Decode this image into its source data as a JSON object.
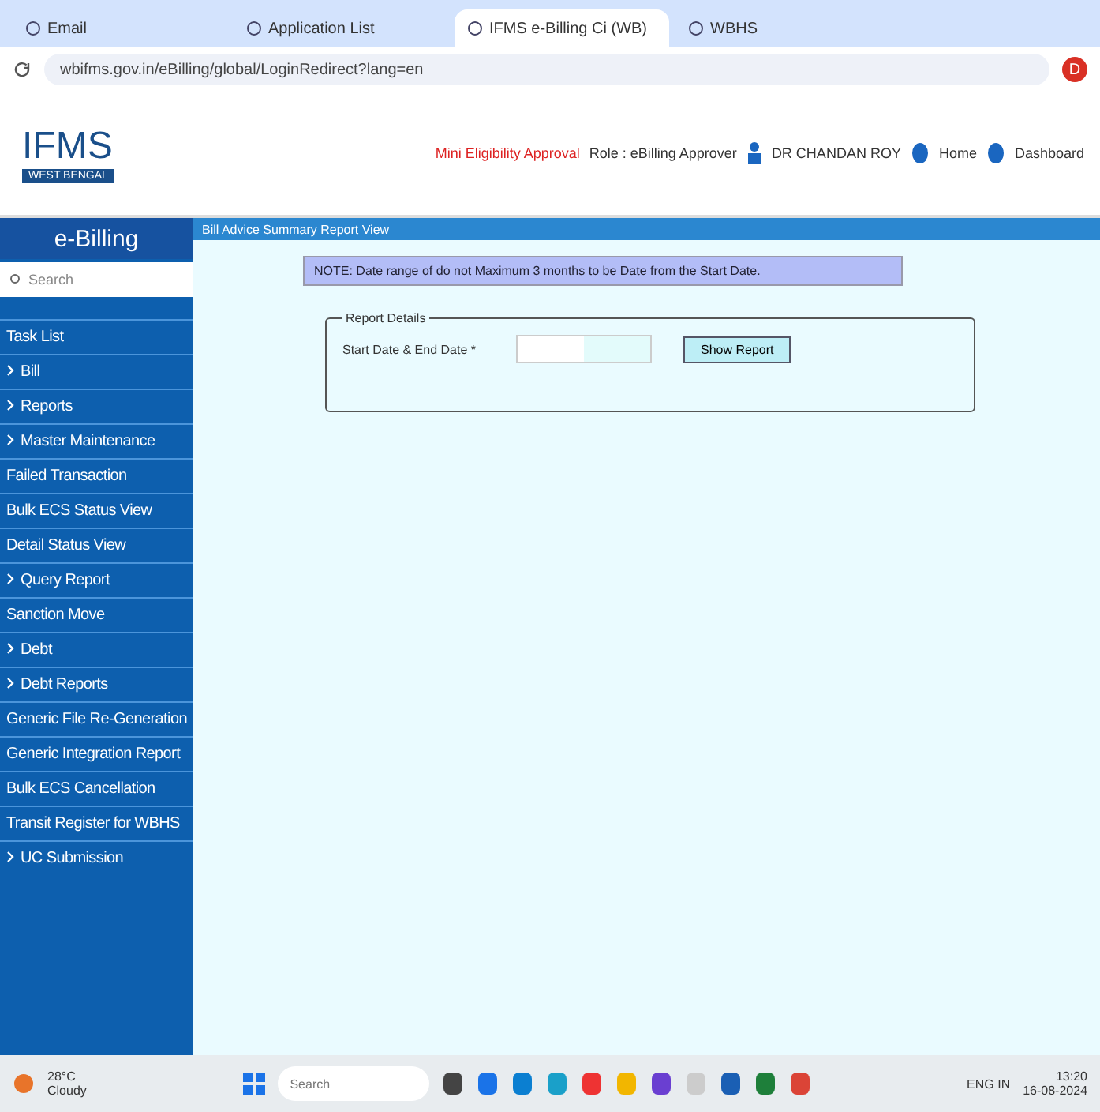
{
  "browser": {
    "tabs": [
      {
        "title": "Email",
        "selected": false
      },
      {
        "title": "Application List",
        "selected": false
      },
      {
        "title": "IFMS e-Billing Ci (WB)",
        "selected": true
      },
      {
        "title": "WBHS",
        "selected": false
      }
    ],
    "url": "wbifms.gov.in/eBilling/global/LoginRedirect?lang=en",
    "profile_initial": "D"
  },
  "header": {
    "logo": "IFMS",
    "logo_sub": "WEST BENGAL",
    "alert": "Mini Eligibility Approval",
    "role": "Role : eBilling Approver",
    "user": "DR CHANDAN ROY",
    "links": [
      "Home",
      "Dashboard"
    ]
  },
  "sidebar": {
    "title": "e-Billing",
    "search_placeholder": "Search",
    "items": [
      {
        "label": "Task List",
        "expandable": false
      },
      {
        "label": "Bill",
        "expandable": true
      },
      {
        "label": "Reports",
        "expandable": true
      },
      {
        "label": "Master Maintenance",
        "expandable": true
      },
      {
        "label": "Failed Transaction",
        "expandable": false
      },
      {
        "label": "Bulk ECS Status View",
        "expandable": false
      },
      {
        "label": "Detail Status View",
        "expandable": false
      },
      {
        "label": "Query Report",
        "expandable": true
      },
      {
        "label": "Sanction Move",
        "expandable": false
      },
      {
        "label": "Debt",
        "expandable": true
      },
      {
        "label": "Debt Reports",
        "expandable": true
      },
      {
        "label": "Generic File Re-Generation",
        "expandable": false
      },
      {
        "label": "Generic Integration Report",
        "expandable": false
      },
      {
        "label": "Bulk ECS Cancellation",
        "expandable": false
      },
      {
        "label": "Transit Register for WBHS",
        "expandable": false
      },
      {
        "label": "UC Submission",
        "expandable": true
      }
    ]
  },
  "page": {
    "title": "Bill Advice Summary Report View",
    "note": "NOTE: Date range of do not Maximum 3 months to be Date from the Start Date.",
    "fieldset": "Report Details",
    "field_label": "Start Date & End Date *",
    "button": "Show Report"
  },
  "taskbar": {
    "weather_temp": "28°C",
    "weather_text": "Cloudy",
    "search_placeholder": "Search",
    "lang": "ENG IN",
    "time": "13:20",
    "date": "16-08-2024"
  }
}
